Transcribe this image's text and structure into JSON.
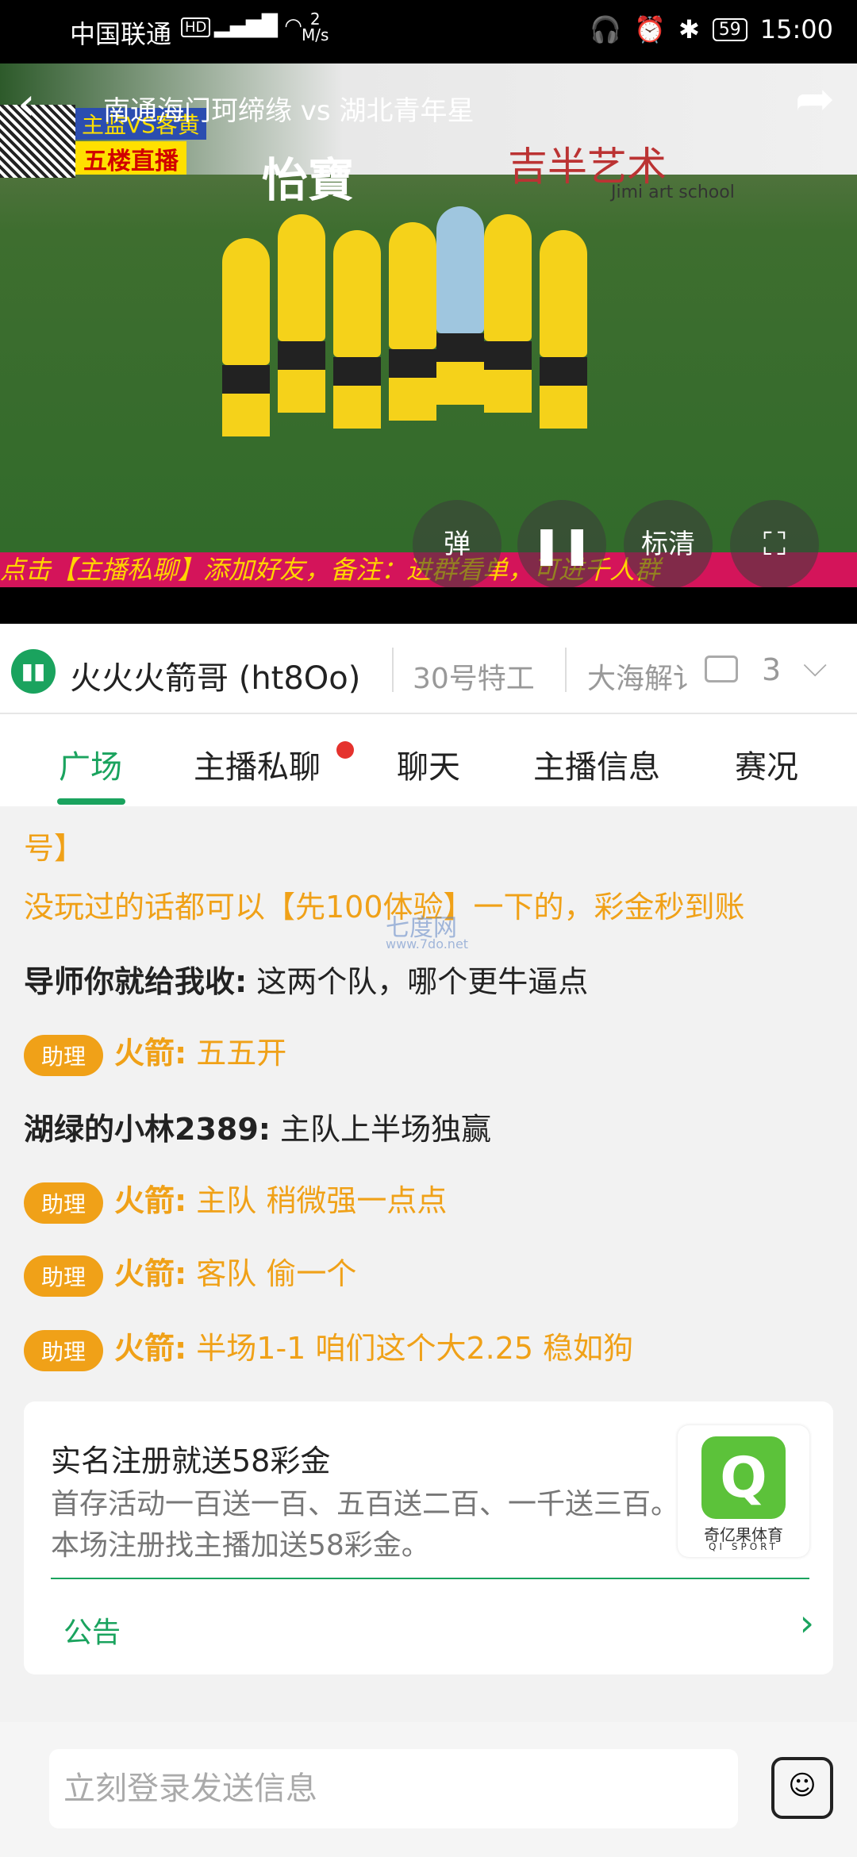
{
  "status_bar": {
    "carrier": "中国联通",
    "hd": "HD",
    "signal": "4G",
    "speed_value": "2",
    "speed_unit": "M/s",
    "battery": "59",
    "time": "15:00"
  },
  "player": {
    "title": "南通海门珂缔缘 vs 湖北青年星",
    "overlay_tag1": "主监VS客黄",
    "overlay_tag2": "五楼直播",
    "sponsor_text": "怡寶",
    "school_text": "吉半艺术",
    "school_sub": "Jimi art school",
    "ticker": "点击【主播私聊】添加好友，备注：进群看单，可进千人群",
    "danmu_label": "弹",
    "quality_label": "标清"
  },
  "anchor_bar": {
    "active_name": "火火火箭哥 (ht8Oo)",
    "other1": "30号特工",
    "other2": "大海解讠",
    "count": "3"
  },
  "tabs": [
    {
      "label": "广场"
    },
    {
      "label": "主播私聊"
    },
    {
      "label": "聊天"
    },
    {
      "label": "主播信息"
    },
    {
      "label": "赛况"
    }
  ],
  "chat": {
    "line0": "号】",
    "line1": "没玩过的话都可以【先100体验】一下的，彩金秒到账",
    "msg2_name": "导师你就给我收:",
    "msg2_text": " 这两个队，哪个更牛逼点",
    "badge": "助理",
    "msg3_name": "火箭:",
    "msg3_text": " 五五开",
    "msg4_name": "湖绿的小林2389:",
    "msg4_text": " 主队上半场独赢",
    "msg5_name": "火箭:",
    "msg5_text": " 主队 稍微强一点点",
    "msg6_name": "火箭:",
    "msg6_text": " 客队 偷一个",
    "msg7_name": "火箭:",
    "msg7_text": " 半场1-1   咱们这个大2.25  稳如狗"
  },
  "watermark": {
    "main": "七度网",
    "sub": "www.7do.net"
  },
  "card": {
    "heading": "实名注册就送58彩金",
    "body": "首存活动一百送一百、五百送二百、一千送三百。本场注册找主播加送58彩金。",
    "logo_text": "奇亿果体育",
    "logo_sub": "QI SPORT",
    "notice_label": "公告"
  },
  "input": {
    "placeholder": "立刻登录发送信息"
  },
  "colors": {
    "accent": "#1aa35e",
    "orange": "#f0a118",
    "ticker_bg": "#d4145a"
  }
}
